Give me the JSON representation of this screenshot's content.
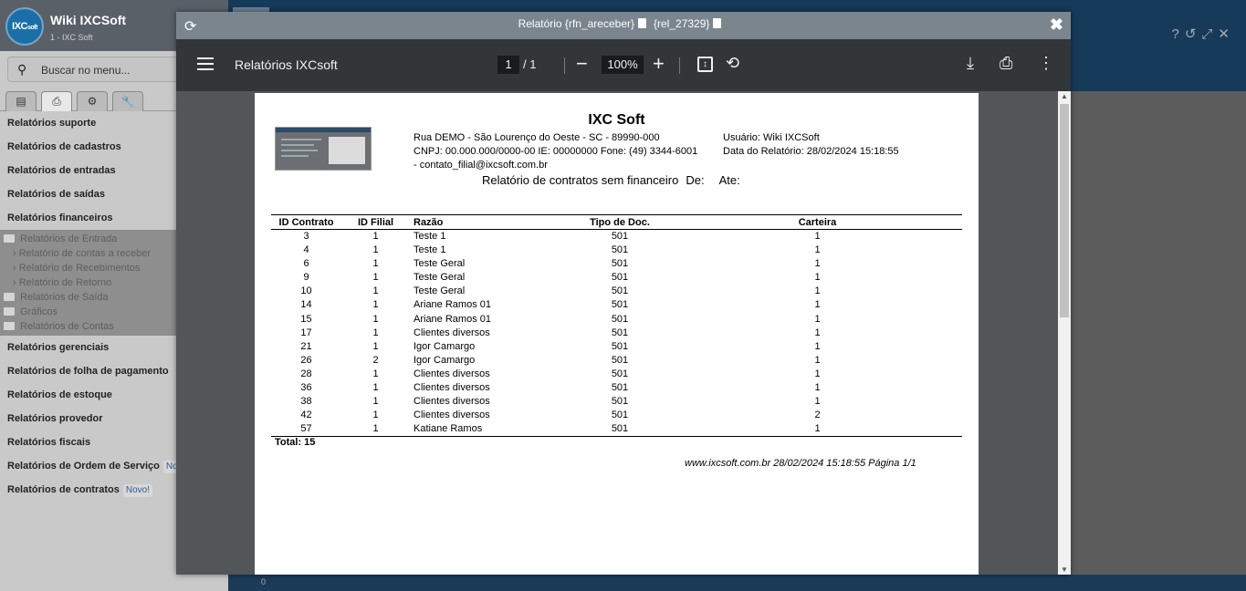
{
  "sidebar": {
    "app_name": "Wiki IXCSoft",
    "app_subtitle": "1 - IXC Soft",
    "logo_text": "IXC",
    "logo_suffix": "soft",
    "search_placeholder": "Buscar no menu...",
    "menu_top": [
      "Relatórios suporte",
      "Relatórios de cadastros",
      "Relatórios de entradas",
      "Relatórios de saídas",
      "Relatórios financeiros"
    ],
    "submenu": {
      "entrada_folder": "Relatórios de Entrada",
      "entrada_items": [
        "Relatório de contas a receber",
        "Relatório de Recebimentos",
        "Relatório de Retorno"
      ],
      "other_folders": [
        "Relatórios de Saída",
        "Gráficos",
        "Relatórios de Contas"
      ]
    },
    "menu_bottom": [
      "Relatórios gerenciais",
      "Relatórios de folha de pagamento",
      "Relatórios de estoque",
      "Relatórios provedor",
      "Relatórios fiscais",
      "Relatórios de Ordem de Serviço",
      "Relatórios de contratos"
    ],
    "badge_os": "No",
    "badge_contratos": "Novo!"
  },
  "background": {
    "strip_value": "0"
  },
  "modal": {
    "title_left": "Relatório {rfn_areceber}",
    "title_right": "{rel_27329}"
  },
  "pdf_toolbar": {
    "doc_name": "Relatórios IXCsoft",
    "page_current": "1",
    "page_total": "/  1",
    "zoom": "100%"
  },
  "report": {
    "company": "IXC Soft",
    "address": "Rua DEMO - São Lourenço do Oeste - SC - 89990-000",
    "cnpj_line": "CNPJ: 00.000.000/0000-00  IE: 00000000  Fone: (49) 3344-6001",
    "email_line": " - contato_filial@ixcsoft.com.br",
    "user": "Usuário: Wiki IXCSoft",
    "date": "Data do Relatório: 28/02/2024 15:18:55",
    "title": "Relatório de contratos sem financeiro",
    "de": "De:",
    "ate": "Ate:",
    "columns": [
      "ID Contrato",
      "ID Filial",
      "Razão",
      "Tipo de Doc.",
      "Carteira"
    ],
    "rows": [
      [
        "3",
        "1",
        "Teste 1",
        "501",
        "1"
      ],
      [
        "4",
        "1",
        "Teste 1",
        "501",
        "1"
      ],
      [
        "6",
        "1",
        "Teste Geral",
        "501",
        "1"
      ],
      [
        "9",
        "1",
        "Teste Geral",
        "501",
        "1"
      ],
      [
        "10",
        "1",
        "Teste Geral",
        "501",
        "1"
      ],
      [
        "14",
        "1",
        "Ariane Ramos 01",
        "501",
        "1"
      ],
      [
        "15",
        "1",
        "Ariane Ramos 01",
        "501",
        "1"
      ],
      [
        "17",
        "1",
        "Clientes diversos",
        "501",
        "1"
      ],
      [
        "21",
        "1",
        "Igor Camargo",
        "501",
        "1"
      ],
      [
        "26",
        "2",
        "Igor Camargo",
        "501",
        "1"
      ],
      [
        "28",
        "1",
        "Clientes diversos",
        "501",
        "1"
      ],
      [
        "36",
        "1",
        "Clientes diversos",
        "501",
        "1"
      ],
      [
        "38",
        "1",
        "Clientes diversos",
        "501",
        "1"
      ],
      [
        "42",
        "1",
        "Clientes diversos",
        "501",
        "2"
      ],
      [
        "57",
        "1",
        "Katiane Ramos",
        "501",
        "1"
      ]
    ],
    "total": "Total: 15",
    "footer": "www.ixcsoft.com.br  28/02/2024 15:18:55  Página 1/1"
  }
}
